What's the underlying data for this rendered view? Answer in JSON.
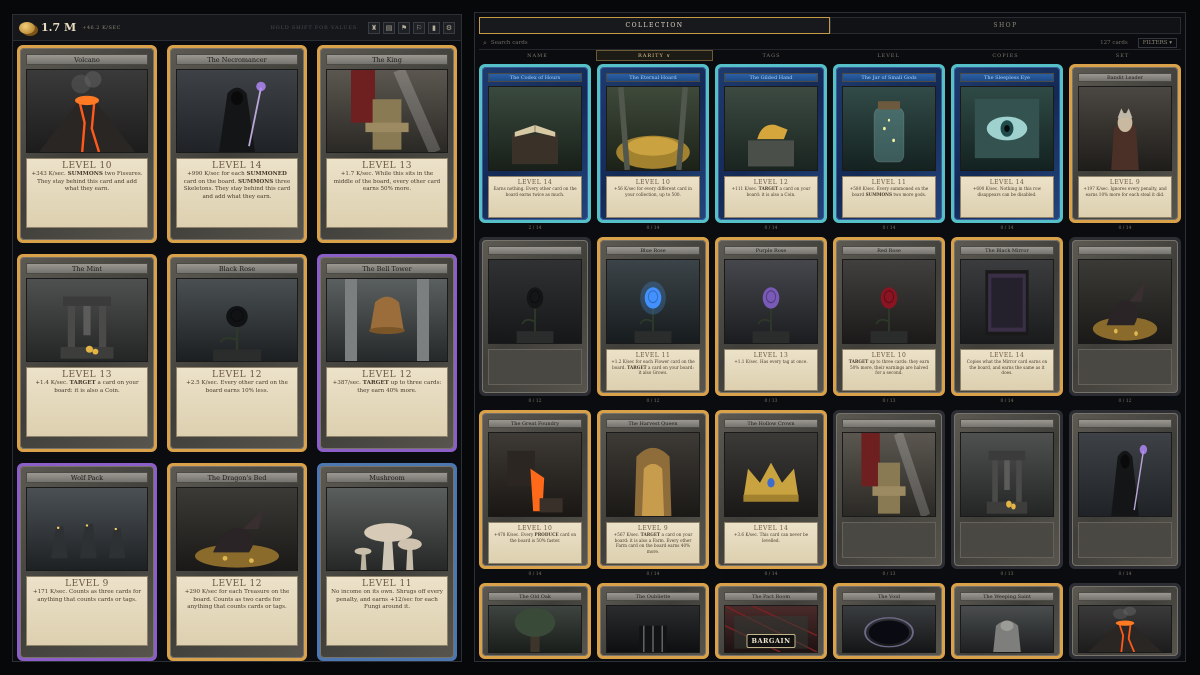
{
  "header": {
    "currency": "1.7 M",
    "rate": "+46.2 K/SEC",
    "hint": "HOLD SHIFT FOR VALUES",
    "tools": [
      {
        "icon": "trophy-icon",
        "glyph": "♜"
      },
      {
        "icon": "book-icon",
        "glyph": "▤"
      },
      {
        "icon": "flag-icon",
        "glyph": "⚑"
      },
      {
        "icon": "banner-icon",
        "glyph": "⚐"
      },
      {
        "icon": "stats-icon",
        "glyph": "▮"
      },
      {
        "icon": "gear-icon",
        "glyph": "⚙"
      }
    ]
  },
  "board": [
    {
      "name": "Volcano",
      "level": "LEVEL 10",
      "desc": "+343 K/sec. SUMMONS two Fissures. They stay behind this card and add what they earn.",
      "rarity": "gold",
      "art": "volcano"
    },
    {
      "name": "The Necromancer",
      "level": "LEVEL 14",
      "desc": "+990 K/sec for each SUMMONED card on the board. SUMMONS three Skeletons. They stay behind this card and add what they earn.",
      "rarity": "gold",
      "art": "necro"
    },
    {
      "name": "The King",
      "level": "LEVEL 13",
      "desc": "+1.7 K/sec. While this sits in the middle of the board, every other card earns 50% more.",
      "rarity": "gold",
      "art": "throne"
    },
    {
      "name": "The Mint",
      "level": "LEVEL 13",
      "desc": "+1.4 K/sec. TARGET a card on your board: it is also a Coin.",
      "rarity": "gold",
      "art": "press"
    },
    {
      "name": "Black Rose",
      "level": "LEVEL 12",
      "desc": "+2.5 K/sec. Every other card on the board earns 10% less.",
      "rarity": "gold",
      "art": "rose-black"
    },
    {
      "name": "The Bell Tower",
      "level": "LEVEL 12",
      "desc": "+387/sec. TARGET up to three cards: they earn 40% more.",
      "rarity": "purple",
      "art": "bell"
    },
    {
      "name": "Wolf Pack",
      "level": "LEVEL 9",
      "desc": "+171 K/sec. Counts as three cards for anything that counts cards or tags.",
      "rarity": "purple",
      "art": "wolves"
    },
    {
      "name": "The Dragon's Bed",
      "level": "LEVEL 12",
      "desc": "+290 K/sec for each Treasure on the board. Counts as two cards for anything that counts cards or tags.",
      "rarity": "gold",
      "art": "dragon"
    },
    {
      "name": "Mushroom",
      "level": "LEVEL 11",
      "desc": "No income on its own. Shrugs off every penalty, and earns +12/sec for each Fungi around it.",
      "rarity": "blue",
      "art": "mushroom"
    }
  ],
  "collection": {
    "tabs": [
      "COLLECTION",
      "SHOP"
    ],
    "search_placeholder": "Search cards",
    "count": "127 cards",
    "filters": "FILTERS ▾",
    "columns": [
      "NAME",
      "RARITY ∨",
      "TAGS",
      "LEVEL",
      "COPIES",
      "SET"
    ],
    "cards": [
      {
        "name": "The Codex of Hours",
        "level": "LEVEL 14",
        "desc": "Earns nothing. Every other card on the board earns twice as much.",
        "rarity": "teal",
        "art": "book",
        "copies": "2 / 14"
      },
      {
        "name": "The Eternal Hoard",
        "level": "LEVEL 10",
        "desc": "+56 K/sec for every different card in your collection, up to 500.",
        "rarity": "teal",
        "art": "hoard",
        "copies": "0 / 14"
      },
      {
        "name": "The Gilded Hand",
        "level": "LEVEL 12",
        "desc": "+111 K/sec. TARGET a card on your board: it is also a Coin.",
        "rarity": "teal",
        "art": "hand",
        "copies": "0 / 14"
      },
      {
        "name": "The Jar of Small Gods",
        "level": "LEVEL 11",
        "desc": "+580 K/sec. Every summoned on the board SUMMONS two more gods.",
        "rarity": "teal",
        "art": "jar",
        "copies": "0 / 14"
      },
      {
        "name": "The Sleepless Eye",
        "level": "LEVEL 14",
        "desc": "+600 K/sec. Nothing in this row disappears can be disabled.",
        "rarity": "teal",
        "art": "eye",
        "copies": "0 / 14"
      },
      {
        "name": "Bandit Leader",
        "level": "LEVEL 9",
        "desc": "+197 K/sec. Ignores every penalty, and earns 10% more for each steal it did.",
        "rarity": "gold",
        "art": "bandit",
        "copies": "0 / 14"
      },
      {
        "name": "",
        "level": "",
        "desc": "",
        "rarity": "none",
        "art": "rose-dark",
        "copies": "0 / 12"
      },
      {
        "name": "Blue Rose",
        "level": "LEVEL 11",
        "desc": "+1.2 K/sec for each Flower card on the board. TARGET a card on your board: it also Grows.",
        "rarity": "gold",
        "art": "rose-blue",
        "copies": "0 / 12"
      },
      {
        "name": "Purple Rose",
        "level": "LEVEL 13",
        "desc": "+1.1 K/sec. Has every tag at once.",
        "rarity": "gold",
        "art": "rose-purple",
        "copies": "0 / 13"
      },
      {
        "name": "Red Rose",
        "level": "LEVEL 10",
        "desc": "TARGET up to three cards: they earn 50% more, their earnings are halved for a second.",
        "rarity": "gold",
        "art": "rose-red",
        "copies": "0 / 13"
      },
      {
        "name": "The Black Mirror",
        "level": "LEVEL 14",
        "desc": "Copies what the Mirror card earns on the board, and earns the same as it does.",
        "rarity": "gold",
        "art": "mirror",
        "copies": "0 / 14"
      },
      {
        "name": "",
        "level": "",
        "desc": "",
        "rarity": "none",
        "art": "dragon",
        "copies": "0 / 12"
      },
      {
        "name": "The Great Foundry",
        "level": "LEVEL 10",
        "desc": "+478 K/sec. Every PRODUCE card on the board is 50% faster.",
        "rarity": "gold",
        "art": "foundry",
        "copies": "0 / 14"
      },
      {
        "name": "The Harvest Queen",
        "level": "LEVEL 9",
        "desc": "+567 K/sec. TARGET a card on your board: it is also a Farm. Every other Farm card on the board earns 40% more.",
        "rarity": "gold",
        "art": "queen",
        "copies": "0 / 14"
      },
      {
        "name": "The Hollow Crown",
        "level": "LEVEL 14",
        "desc": "+3.6 K/sec. This card can never be levelled.",
        "rarity": "gold",
        "art": "crown",
        "copies": "0 / 14"
      },
      {
        "name": "",
        "level": "",
        "desc": "",
        "rarity": "none",
        "art": "throne",
        "copies": "0 / 13"
      },
      {
        "name": "",
        "level": "",
        "desc": "",
        "rarity": "none",
        "art": "press",
        "copies": "0 / 13"
      },
      {
        "name": "",
        "level": "",
        "desc": "",
        "rarity": "none",
        "art": "necro",
        "copies": "0 / 14"
      },
      {
        "name": "The Old Oak",
        "level": "",
        "desc": "",
        "rarity": "gold",
        "art": "oak",
        "copies": ""
      },
      {
        "name": "The Oubliette",
        "level": "",
        "desc": "",
        "rarity": "gold",
        "art": "oubliette",
        "copies": ""
      },
      {
        "name": "The Pact Room",
        "level": "",
        "desc": "",
        "rarity": "gold",
        "art": "pact",
        "copies": "",
        "badge": "BARGAIN"
      },
      {
        "name": "The Void",
        "level": "",
        "desc": "",
        "rarity": "gold",
        "art": "void",
        "copies": ""
      },
      {
        "name": "The Weeping Saint",
        "level": "",
        "desc": "",
        "rarity": "gold",
        "art": "saint",
        "copies": ""
      },
      {
        "name": "",
        "level": "",
        "desc": "",
        "rarity": "none",
        "art": "volcano",
        "copies": ""
      }
    ]
  },
  "colors": {
    "gold": "#d9a24a",
    "purple": "#8b5fc7",
    "blue": "#4d77b0",
    "teal": "#55c0c8"
  }
}
